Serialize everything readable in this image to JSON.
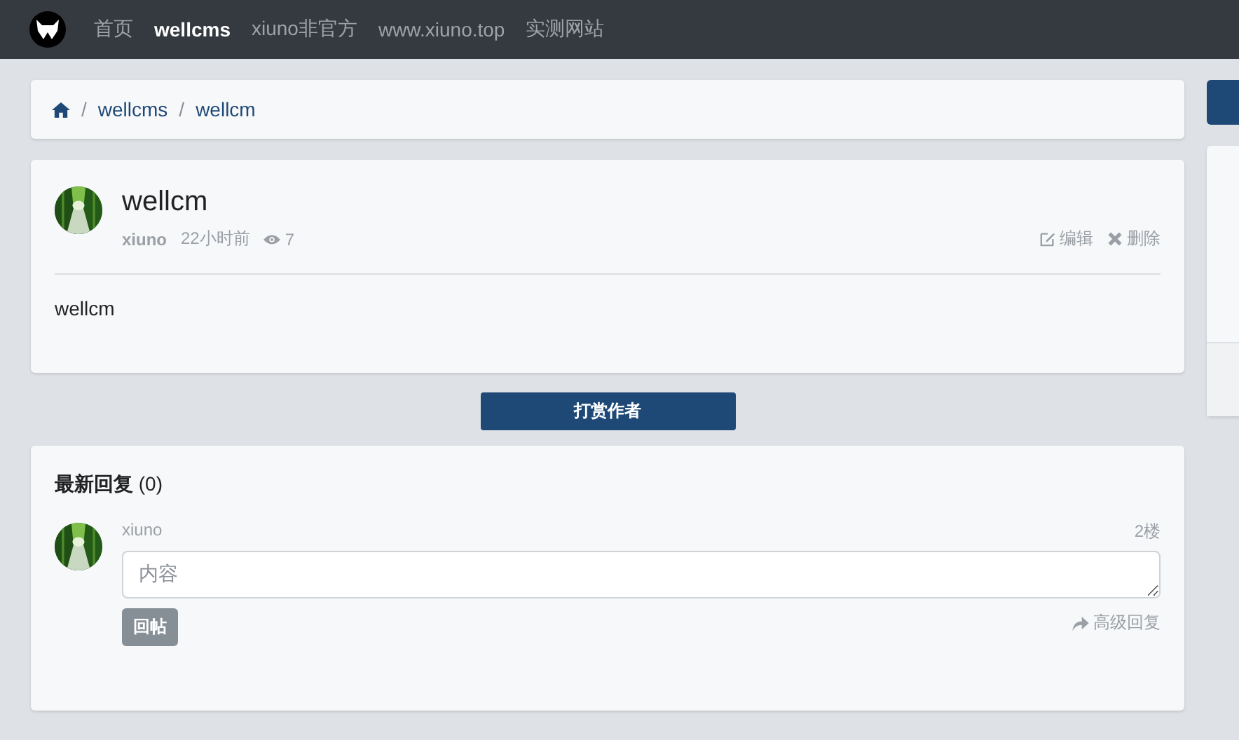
{
  "nav": {
    "items": [
      {
        "label": "首页",
        "selected": false
      },
      {
        "label": "wellcms",
        "selected": true
      },
      {
        "label": "xiuno非官方",
        "selected": false
      },
      {
        "label": "www.xiuno.top",
        "selected": false
      },
      {
        "label": "实测网站",
        "selected": false
      }
    ]
  },
  "breadcrumb": [
    {
      "separator": "/",
      "label": "wellcms"
    },
    {
      "separator": "/",
      "label": "wellcm"
    }
  ],
  "thread": {
    "title": "wellcm",
    "author": "xiuno",
    "time": "22小时前",
    "views": "7",
    "actions": [
      {
        "kind": "edit",
        "label": "编辑"
      },
      {
        "kind": "delete",
        "label": "删除"
      }
    ],
    "body": "wellcm"
  },
  "reward_button": "打赏作者",
  "replies": {
    "title": "最新回复",
    "count": "(0)",
    "form": {
      "author": "xiuno",
      "floor": "2楼",
      "placeholder": "内容",
      "submit": "回帖",
      "advanced": "高级回复"
    }
  }
}
